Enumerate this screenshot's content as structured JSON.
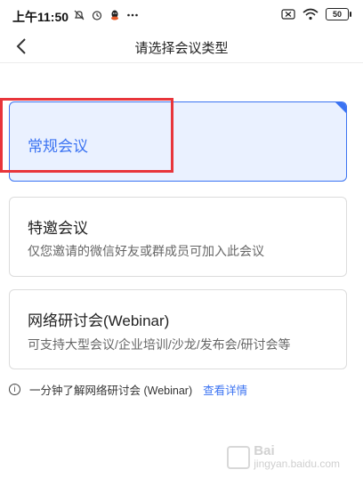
{
  "status_bar": {
    "time": "上午11:50",
    "left_icons": [
      "mute-icon",
      "alarm-icon",
      "qq-icon",
      "more-dots-icon"
    ],
    "right_icons": [
      "sim-off-icon",
      "wifi-icon",
      "battery-icon"
    ],
    "battery_level": "50"
  },
  "nav": {
    "title": "请选择会议类型"
  },
  "options": [
    {
      "title": "常规会议",
      "subtitle": "",
      "selected": true
    },
    {
      "title": "特邀会议",
      "subtitle": "仅您邀请的微信好友或群成员可加入此会议",
      "selected": false
    },
    {
      "title": "网络研讨会(Webinar)",
      "subtitle": "可支持大型会议/企业培训/沙龙/发布会/研讨会等",
      "selected": false
    }
  ],
  "info": {
    "text": "一分钟了解网络研讨会 (Webinar)",
    "link": "查看详情"
  },
  "watermark": {
    "line1": "Bai",
    "line2": "jingyan.baidu.com"
  },
  "colors": {
    "accent": "#3b73f2",
    "selected_bg": "#eaf1ff",
    "highlight": "#e8353b"
  }
}
